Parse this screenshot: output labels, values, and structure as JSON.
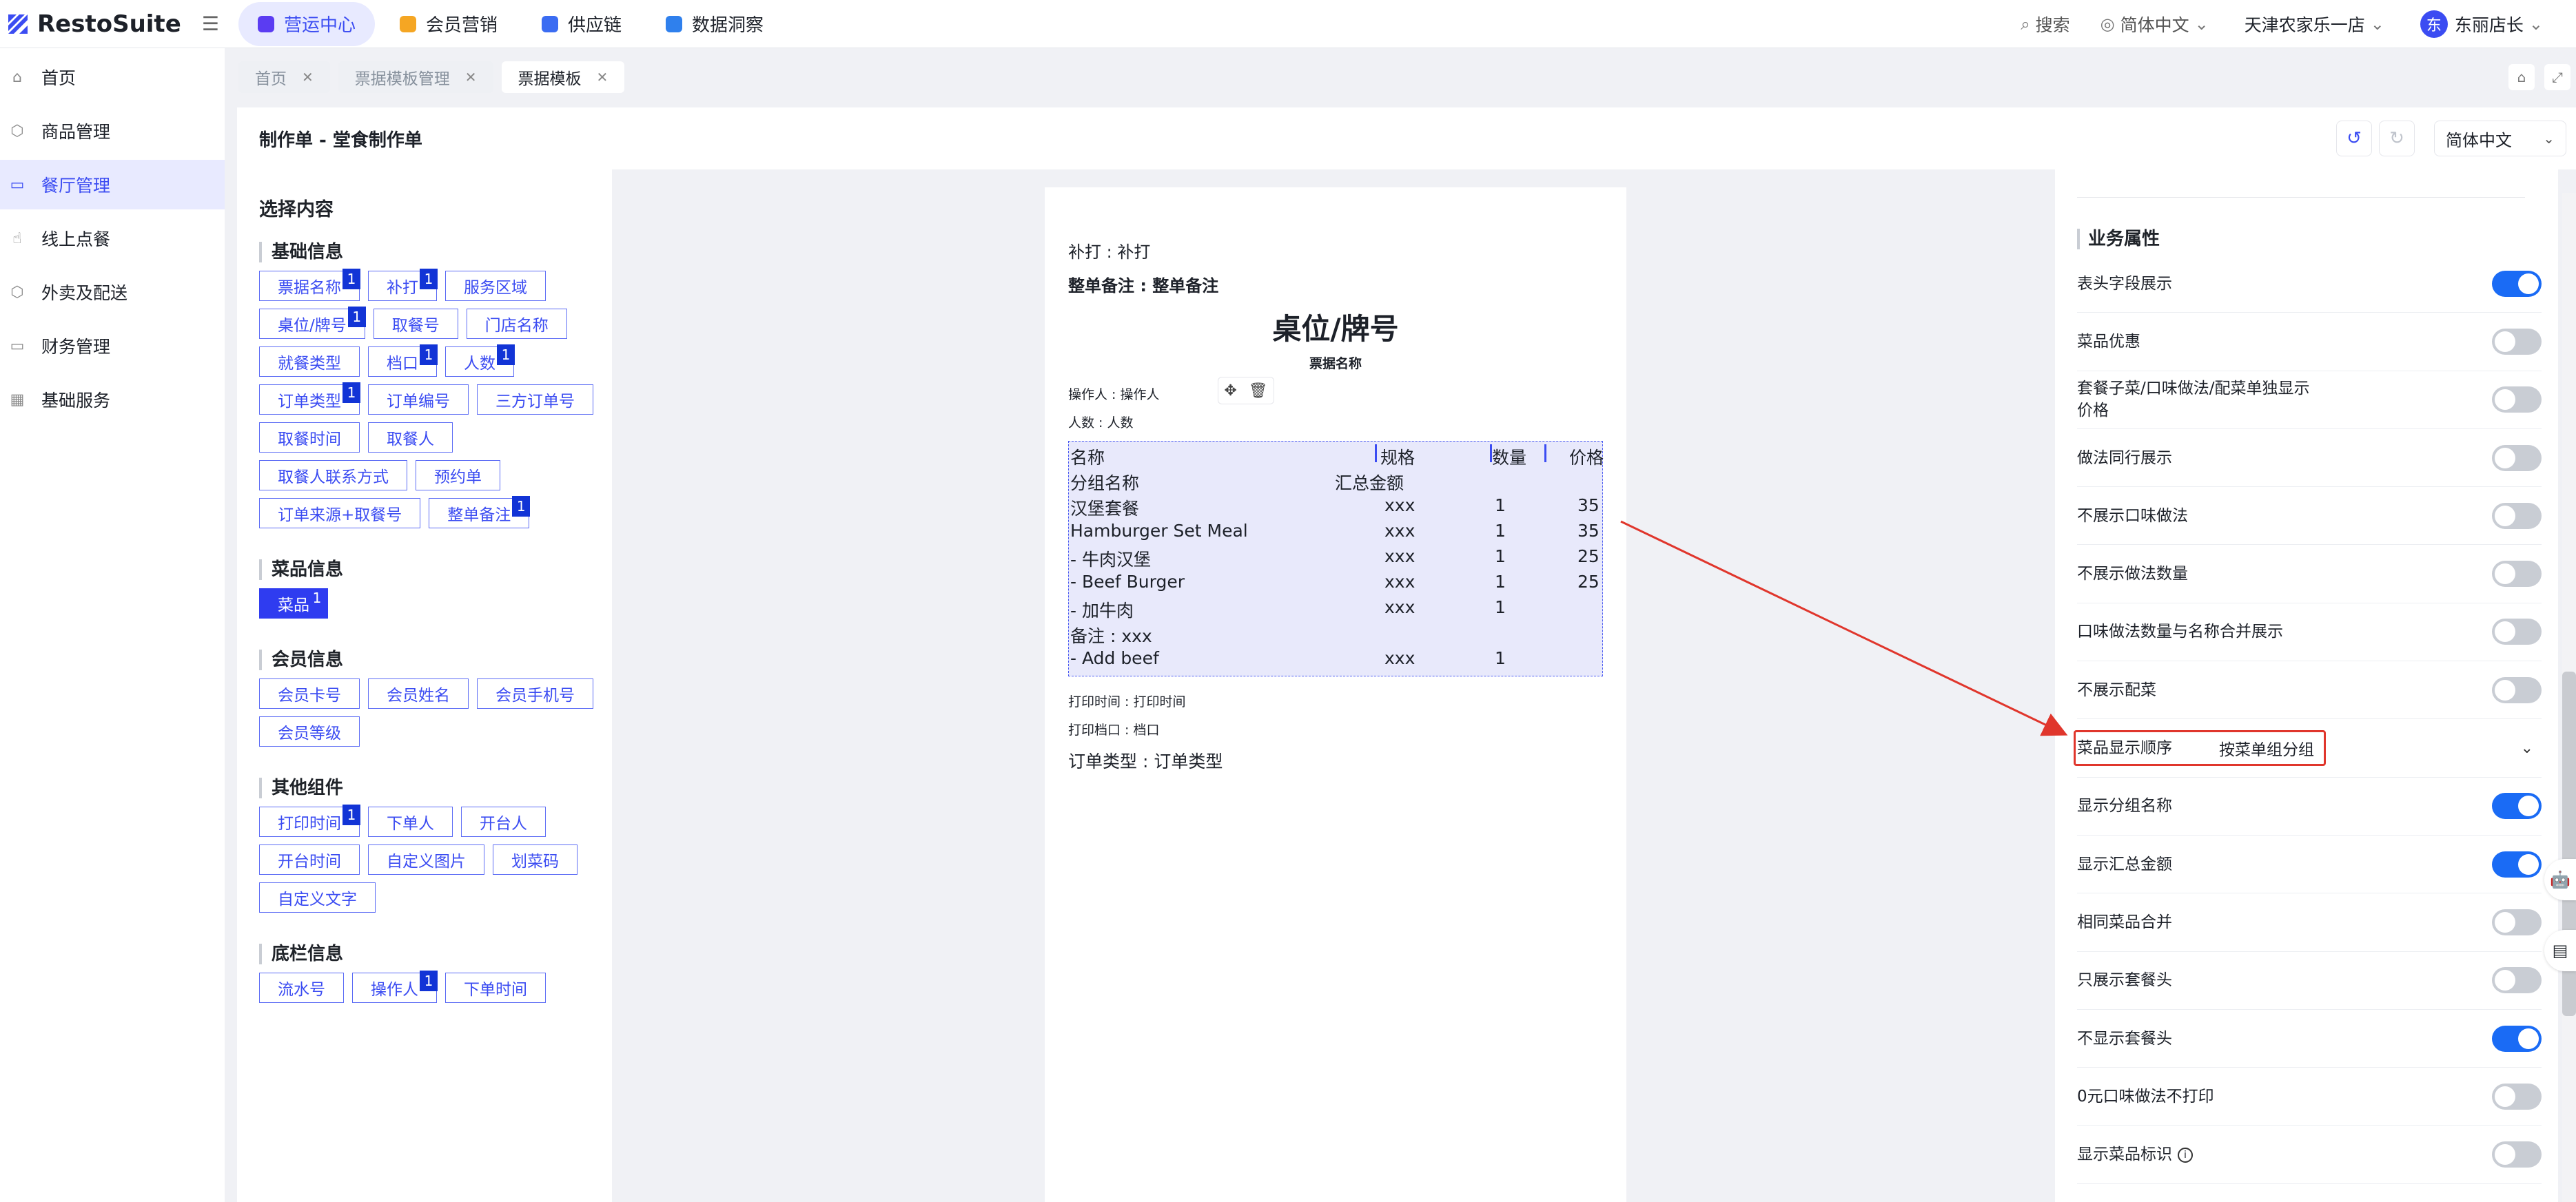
{
  "app": {
    "logo_text": "RestoSuite",
    "colors": {
      "accent": "#3b4cf2",
      "toggle_on": "#1a6bf5",
      "annotation": "#e0362c"
    }
  },
  "topnav": {
    "tabs": [
      {
        "label": "营运中心",
        "icon": "cube-icon",
        "color": "#5b3cf2",
        "active": true
      },
      {
        "label": "会员营销",
        "icon": "members-icon",
        "color": "#f5a623",
        "active": false
      },
      {
        "label": "供应链",
        "icon": "supply-icon",
        "color": "#3b6cf2",
        "active": false
      },
      {
        "label": "数据洞察",
        "icon": "insight-icon",
        "color": "#2f80ed",
        "active": false
      }
    ],
    "search_label": "搜索",
    "language": "简体中文",
    "store": "天津农家乐一店",
    "avatar_char": "东",
    "user": "东丽店长"
  },
  "sidebar": {
    "items": [
      {
        "label": "首页",
        "icon": "home-icon",
        "active": false
      },
      {
        "label": "商品管理",
        "icon": "box-icon",
        "active": false
      },
      {
        "label": "餐厅管理",
        "icon": "store-icon",
        "active": true
      },
      {
        "label": "线上点餐",
        "icon": "hand-icon",
        "active": false
      },
      {
        "label": "外卖及配送",
        "icon": "delivery-icon",
        "active": false
      },
      {
        "label": "财务管理",
        "icon": "folder-icon",
        "active": false
      },
      {
        "label": "基础服务",
        "icon": "grid-icon",
        "active": false
      }
    ]
  },
  "pagetabs": [
    {
      "label": "首页",
      "active": false
    },
    {
      "label": "票据模板管理",
      "active": false
    },
    {
      "label": "票据模板",
      "active": true
    }
  ],
  "header": {
    "title": "制作单 - 堂食制作单",
    "language": "简体中文"
  },
  "leftpanel": {
    "title": "选择内容",
    "sections": [
      {
        "heading": "基础信息",
        "chips": [
          {
            "label": "票据名称",
            "badge": "1"
          },
          {
            "label": "补打",
            "badge": "1"
          },
          {
            "label": "服务区域",
            "badge": ""
          },
          {
            "label": "桌位/牌号",
            "badge": "1"
          },
          {
            "label": "取餐号",
            "badge": ""
          },
          {
            "label": "门店名称",
            "badge": ""
          },
          {
            "label": "就餐类型",
            "badge": ""
          },
          {
            "label": "档口",
            "badge": "1"
          },
          {
            "label": "人数",
            "badge": "1"
          },
          {
            "label": "订单类型",
            "badge": "1"
          },
          {
            "label": "订单编号",
            "badge": ""
          },
          {
            "label": "三方订单号",
            "badge": ""
          },
          {
            "label": "取餐时间",
            "badge": ""
          },
          {
            "label": "取餐人",
            "badge": ""
          },
          {
            "label": "取餐人联系方式",
            "badge": ""
          },
          {
            "label": "预约单",
            "badge": ""
          },
          {
            "label": "订单来源+取餐号",
            "badge": ""
          },
          {
            "label": "整单备注",
            "badge": "1"
          }
        ]
      },
      {
        "heading": "菜品信息",
        "chips": [
          {
            "label": "菜品",
            "badge": "1",
            "filled": true
          }
        ]
      },
      {
        "heading": "会员信息",
        "chips": [
          {
            "label": "会员卡号",
            "badge": ""
          },
          {
            "label": "会员姓名",
            "badge": ""
          },
          {
            "label": "会员手机号",
            "badge": ""
          },
          {
            "label": "会员等级",
            "badge": ""
          }
        ]
      },
      {
        "heading": "其他组件",
        "chips": [
          {
            "label": "打印时间",
            "badge": "1"
          },
          {
            "label": "下单人",
            "badge": ""
          },
          {
            "label": "开台人",
            "badge": ""
          },
          {
            "label": "开台时间",
            "badge": ""
          },
          {
            "label": "自定义图片",
            "badge": ""
          },
          {
            "label": "划菜码",
            "badge": ""
          },
          {
            "label": "自定义文字",
            "badge": ""
          }
        ]
      },
      {
        "heading": "底栏信息",
        "chips": [
          {
            "label": "流水号",
            "badge": ""
          },
          {
            "label": "操作人",
            "badge": "1"
          },
          {
            "label": "下单时间",
            "badge": ""
          }
        ]
      }
    ]
  },
  "ticket": {
    "reprint": "补打 : 补打",
    "order_note": "整单备注 : 整单备注",
    "table_no": "桌位/牌号",
    "ticket_name": "票据名称",
    "operator": "操作人 : 操作人",
    "guests": "人数 : 人数",
    "columns": {
      "name": "名称",
      "spec": "规格",
      "qty": "数量",
      "price": "价格"
    },
    "group_row": {
      "name": "分组名称",
      "total": "汇总金额"
    },
    "rows": [
      {
        "name": "汉堡套餐",
        "spec": "xxx",
        "qty": "1",
        "price": "35"
      },
      {
        "name": "Hamburger Set Meal",
        "spec": "xxx",
        "qty": "1",
        "price": "35"
      },
      {
        "name": " - 牛肉汉堡",
        "spec": "xxx",
        "qty": "1",
        "price": "25"
      },
      {
        "name": " - Beef Burger",
        "spec": "xxx",
        "qty": "1",
        "price": "25"
      },
      {
        "name": "   - 加牛肉",
        "spec": "xxx",
        "qty": "1",
        "price": ""
      },
      {
        "name": " 备注 : xxx",
        "spec": "",
        "qty": "",
        "price": ""
      },
      {
        "name": "   - Add beef",
        "spec": "xxx",
        "qty": "1",
        "price": ""
      }
    ],
    "print_time": "打印时间 : 打印时间",
    "stall": "打印档口 : 档口",
    "order_type": "订单类型 : 订单类型"
  },
  "rightpanel": {
    "heading": "业务属性",
    "settings": [
      {
        "label": "表头字段展示",
        "on": true
      },
      {
        "label": "菜品优惠",
        "on": false
      },
      {
        "label": "套餐子菜/口味做法/配菜单独显示价格",
        "on": false
      },
      {
        "label": "做法同行展示",
        "on": false
      },
      {
        "label": "不展示口味做法",
        "on": false
      },
      {
        "label": "不展示做法数量",
        "on": false
      },
      {
        "label": "口味做法数量与名称合并展示",
        "on": false
      },
      {
        "label": "不展示配菜",
        "on": false
      },
      {
        "label": "菜品显示顺序",
        "select": "按菜单组分组"
      },
      {
        "label": "显示分组名称",
        "on": true
      },
      {
        "label": "显示汇总金额",
        "on": true
      },
      {
        "label": "相同菜品合并",
        "on": false
      },
      {
        "label": "只展示套餐头",
        "on": false
      },
      {
        "label": "不显示套餐头",
        "on": true
      },
      {
        "label": "0元口味做法不打印",
        "on": false
      },
      {
        "label": "显示菜品标识",
        "on": false,
        "info": true
      }
    ]
  }
}
